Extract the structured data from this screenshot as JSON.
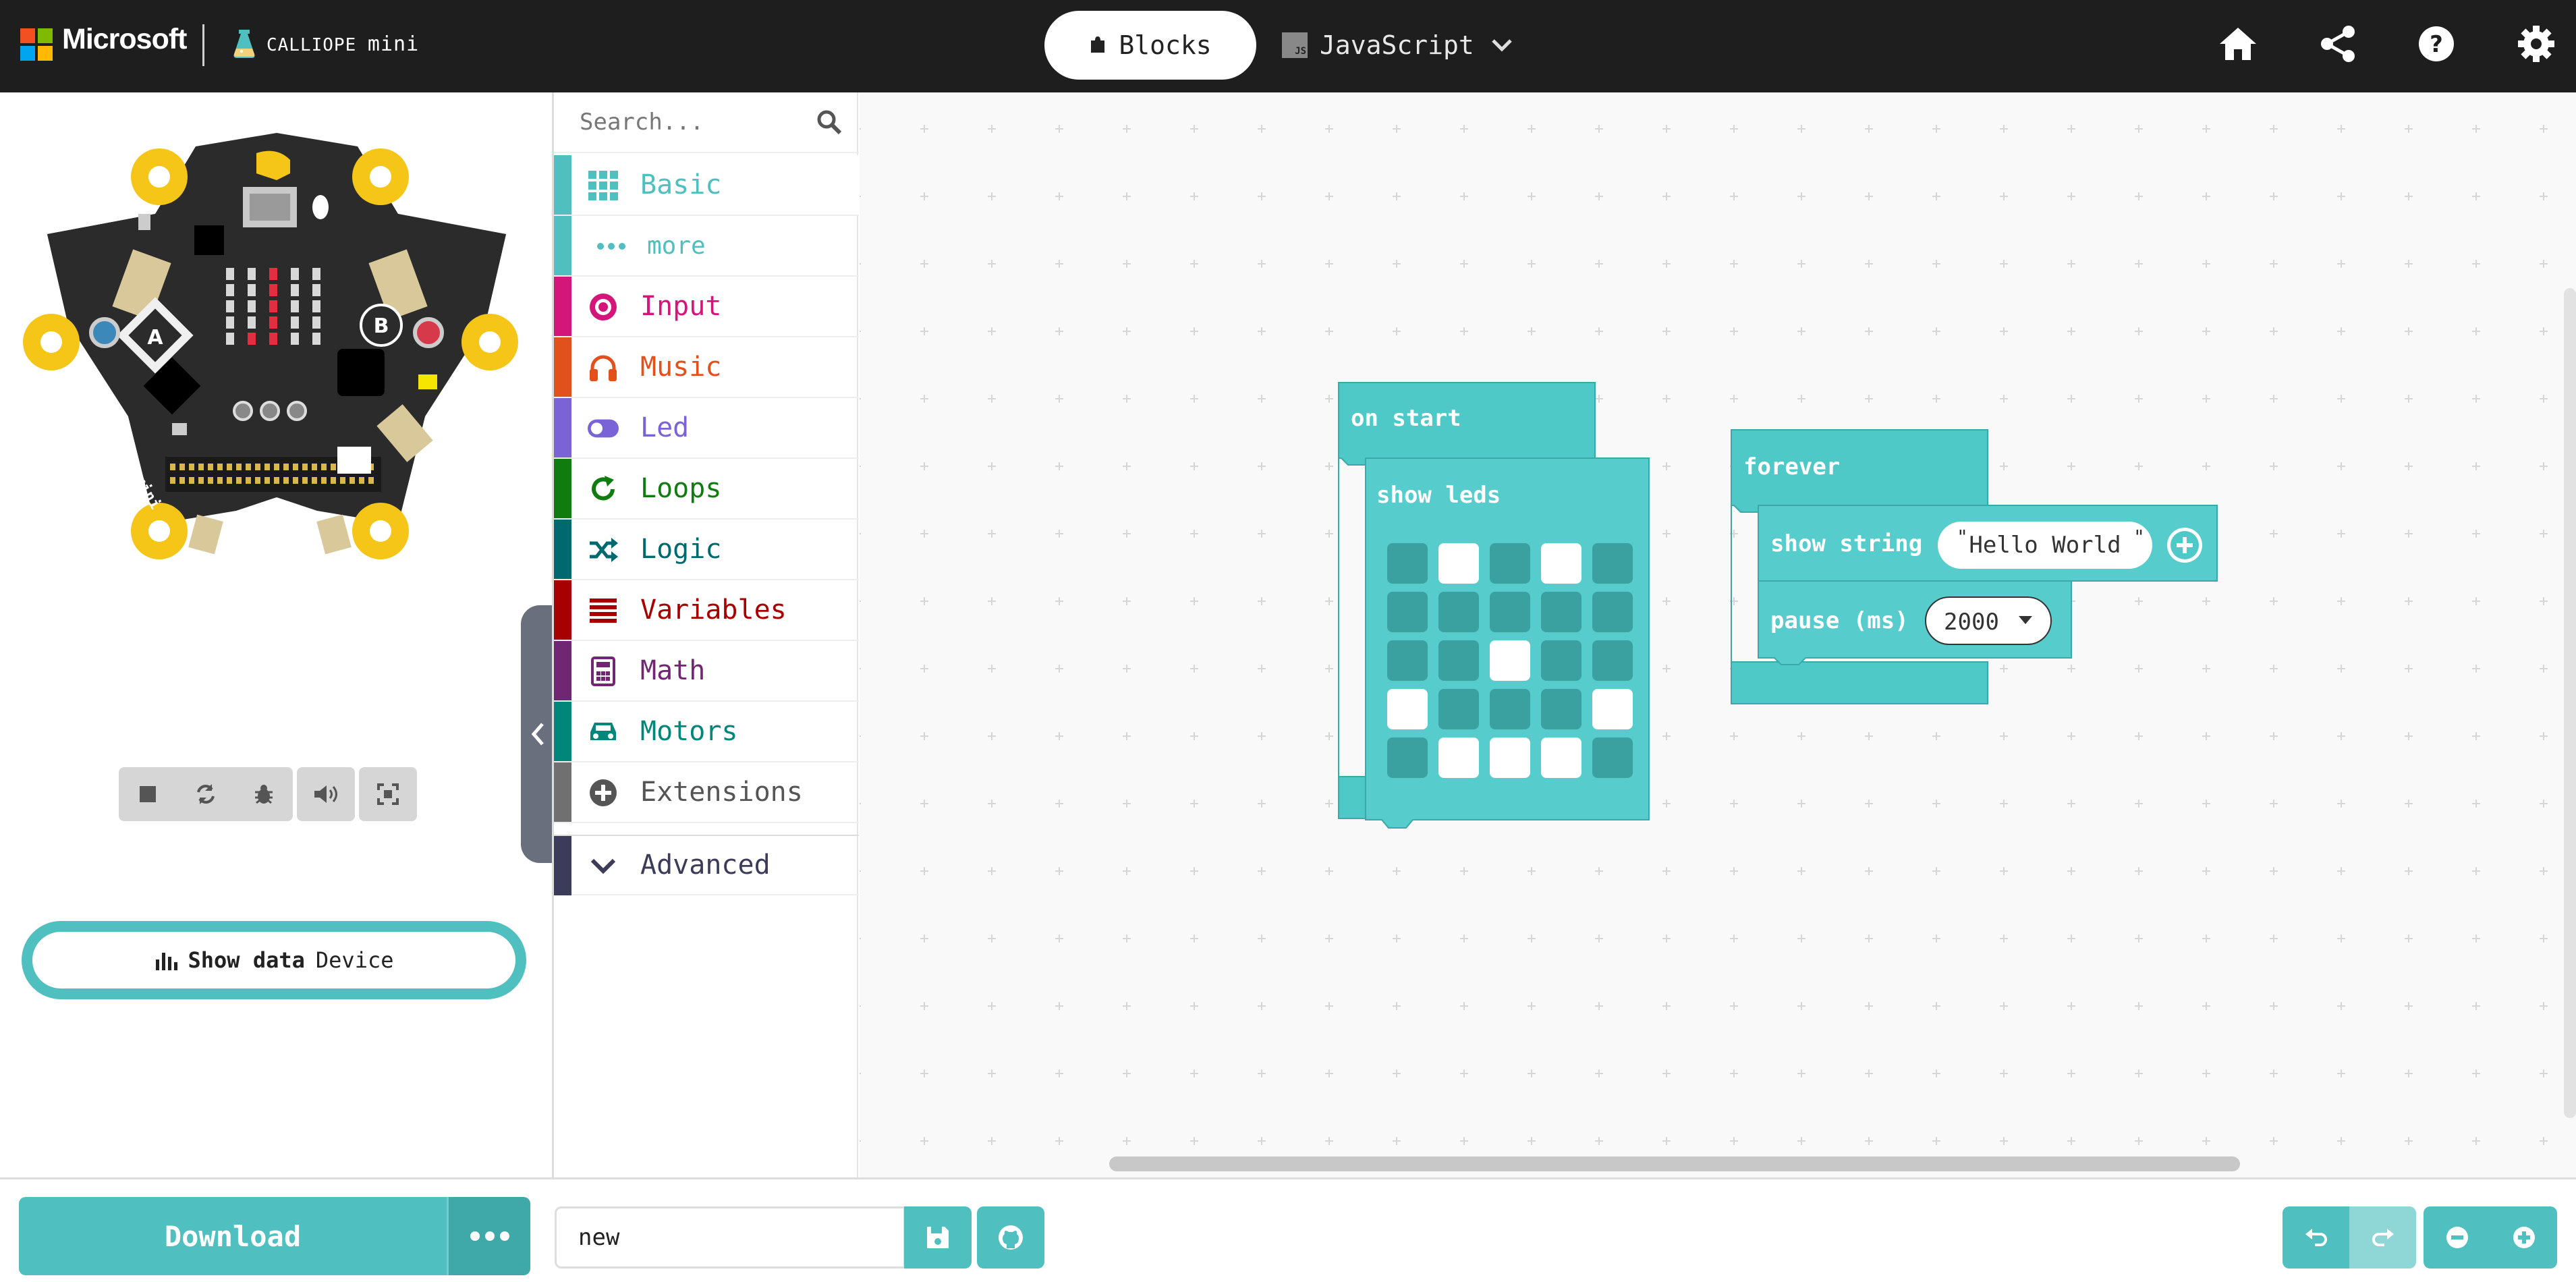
{
  "header": {
    "brand": "Microsoft",
    "product": {
      "name": "CALLIOPE",
      "suffix": "mini"
    },
    "tabs": [
      {
        "label": "Blocks",
        "active": true
      },
      {
        "label": "JavaScript",
        "active": false
      }
    ],
    "js_badge": "JS",
    "icons": [
      "home-icon",
      "share-icon",
      "help-icon",
      "settings-icon"
    ]
  },
  "simulator": {
    "buttons": [
      "stop-icon",
      "restart-icon",
      "debug-icon",
      "sound-icon",
      "fullscreen-icon"
    ],
    "show_data": {
      "bold": "Show data",
      "normal": "Device"
    },
    "board": {
      "button_a": "A",
      "button_b": "B",
      "logo_text": "CALLIOPE mini"
    }
  },
  "toolbox": {
    "search_placeholder": "Search...",
    "categories": [
      {
        "label": "Basic",
        "color": "#4fbfbf",
        "icon": "grid-icon"
      },
      {
        "label": "more",
        "color": "#4fbfbf",
        "icon": "more-icon"
      },
      {
        "label": "Input",
        "color": "#d4157a",
        "icon": "input-icon"
      },
      {
        "label": "Music",
        "color": "#e2511b",
        "icon": "headphones-icon"
      },
      {
        "label": "Led",
        "color": "#7a63d6",
        "icon": "toggle-icon"
      },
      {
        "label": "Loops",
        "color": "#107c10",
        "icon": "loop-icon"
      },
      {
        "label": "Logic",
        "color": "#006970",
        "icon": "shuffle-icon"
      },
      {
        "label": "Variables",
        "color": "#a80000",
        "icon": "list-icon"
      },
      {
        "label": "Math",
        "color": "#712672",
        "icon": "calculator-icon"
      },
      {
        "label": "Motors",
        "color": "#00877a",
        "icon": "car-icon"
      },
      {
        "label": "Extensions",
        "color": "#707070",
        "icon": "plus-circle-icon"
      },
      {
        "label": "Advanced",
        "color": "#3c3c5a",
        "icon": "chevron-down-icon"
      }
    ]
  },
  "workspace": {
    "on_start": {
      "label": "on start",
      "show_leds": {
        "label": "show leds",
        "grid": [
          [
            0,
            1,
            0,
            1,
            0
          ],
          [
            0,
            0,
            0,
            0,
            0
          ],
          [
            0,
            0,
            1,
            0,
            0
          ],
          [
            1,
            0,
            0,
            0,
            1
          ],
          [
            0,
            1,
            1,
            1,
            0
          ]
        ]
      }
    },
    "forever": {
      "label": "forever",
      "show_string": {
        "label": "show string",
        "value": "Hello World"
      },
      "pause": {
        "label": "pause (ms)",
        "value": "2000"
      }
    },
    "block_color": "#4fc8c8"
  },
  "bottom": {
    "download_label": "Download",
    "project_name": "new",
    "icons": [
      "more-icon",
      "save-icon",
      "github-icon",
      "undo-icon",
      "redo-icon",
      "zoom-out-icon",
      "zoom-in-icon"
    ]
  }
}
